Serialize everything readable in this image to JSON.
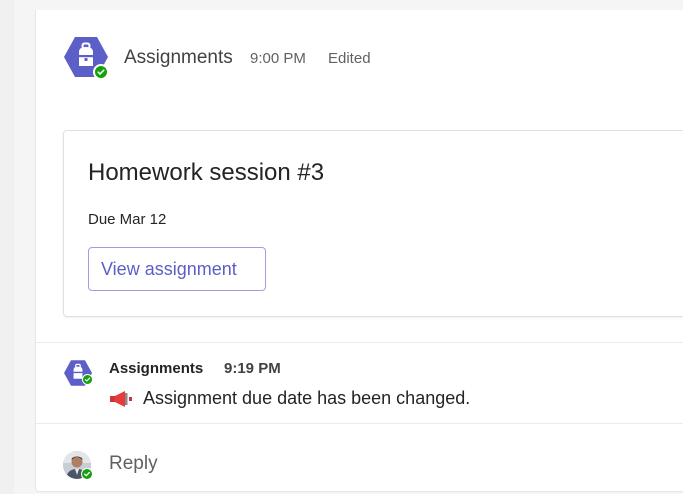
{
  "message": {
    "sender": "Assignments",
    "time": "9:00 PM",
    "edited": "Edited",
    "app_icon": "assignments-backpack-icon",
    "card": {
      "title": "Homework session #3",
      "due": "Due Mar 12",
      "button_label": "View assignment"
    }
  },
  "update": {
    "sender": "Assignments",
    "time": "9:19 PM",
    "icon": "megaphone-icon",
    "text": "Assignment due date has been changed."
  },
  "reply": {
    "label": "Reply"
  },
  "colors": {
    "brand": "#5b5fc7",
    "presence": "#13a10e"
  }
}
